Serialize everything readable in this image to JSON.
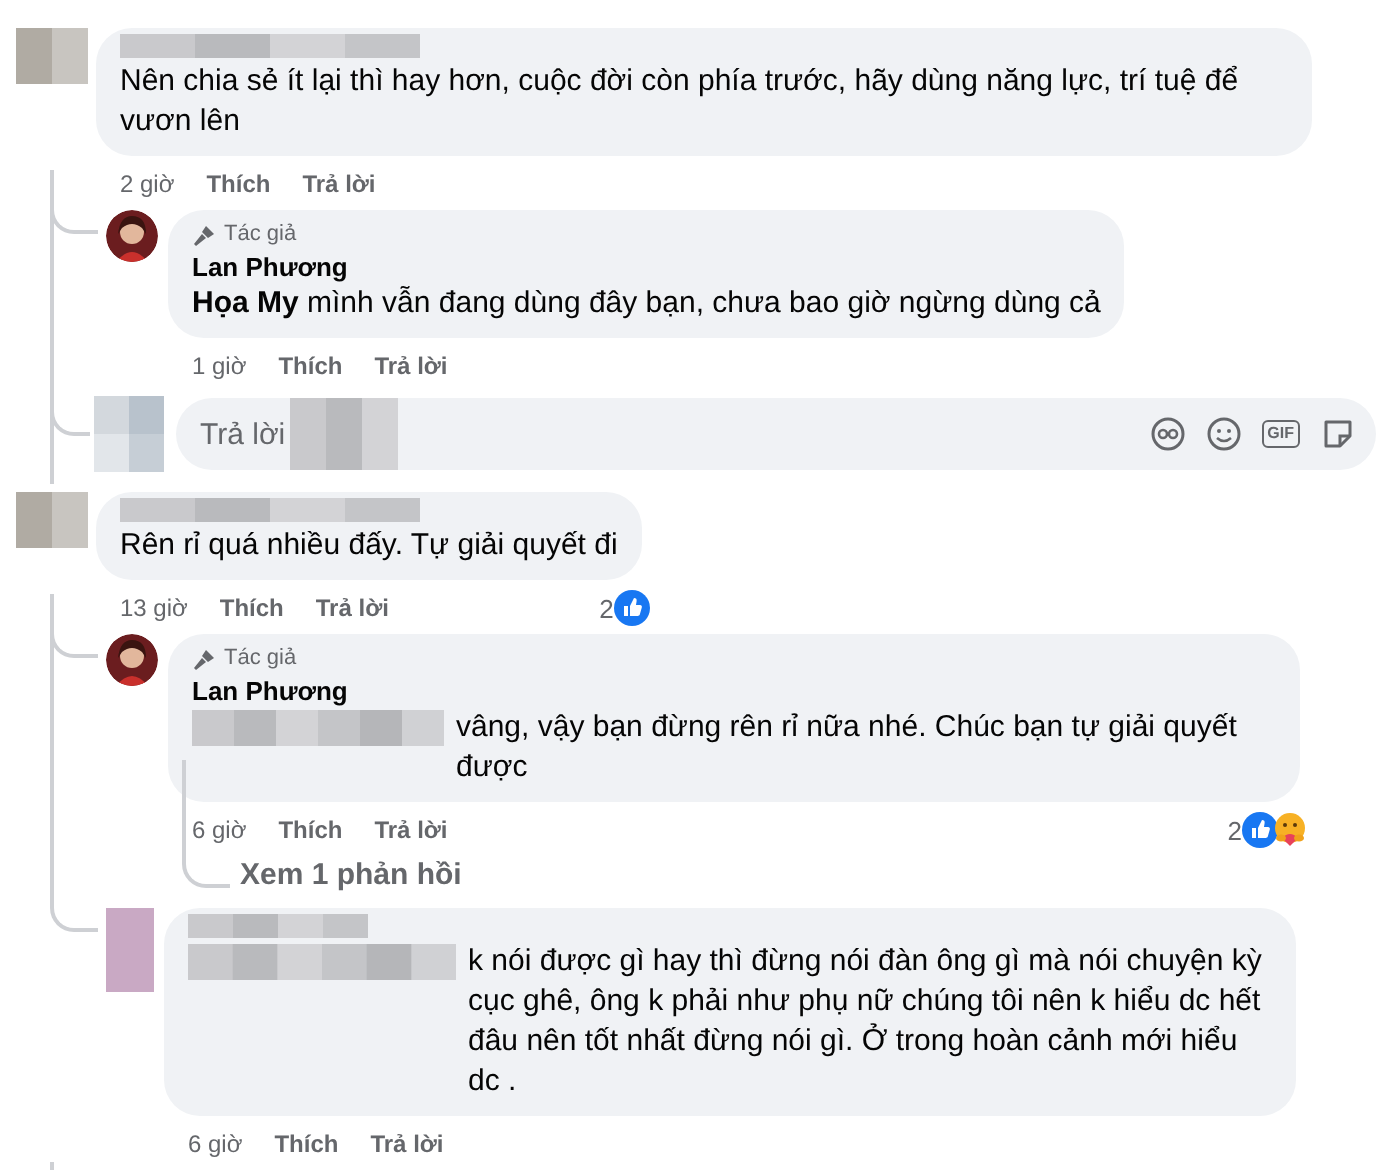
{
  "comments": [
    {
      "text": "Nên chia sẻ ít lại thì hay hơn, cuộc đời còn phía trước, hãy dùng năng lực, trí tuệ để vươn lên",
      "time": "2 giờ",
      "like": "Thích",
      "reply": "Trả lời",
      "replies": [
        {
          "author": "Lan Phương",
          "badge": "Tác giả",
          "text": "**Họa My** mình vẫn đang dùng đây bạn, chưa bao giờ ngừng dùng cả",
          "time": "1 giờ",
          "like": "Thích",
          "reply": "Trả lời"
        }
      ],
      "reply_box": {
        "placeholder": "Trả lời",
        "gif_label": "GIF"
      }
    },
    {
      "text": "Rên rỉ quá nhiều đấy. Tự giải quyết đi",
      "time": "13 giờ",
      "like": "Thích",
      "reply": "Trả lời",
      "reactions": {
        "count": "2",
        "icons": [
          {
            "kind": "like"
          }
        ]
      },
      "replies": [
        {
          "author": "Lan Phương",
          "badge": "Tác giả",
          "mention_redacted": true,
          "text": "vâng, vậy bạn đừng rên rỉ nữa nhé. Chúc bạn tự giải quyết được",
          "time": "6 giờ",
          "like": "Thích",
          "reply": "Trả lời",
          "reactions": {
            "count": "2",
            "icons": [
              {
                "kind": "like"
              },
              {
                "kind": "care"
              }
            ]
          },
          "view_replies": "Xem 1 phản hồi"
        },
        {
          "mention_redacted": true,
          "text": "k nói được gì hay thì đừng nói đàn ông gì mà nói chuyện kỳ cục ghê, ông k phải như phụ nữ chúng tôi nên k hiểu dc hết đâu nên tốt nhất đừng nói gì. Ở trong hoàn cảnh mới hiểu dc .",
          "time": "6 giờ",
          "like": "Thích",
          "reply": "Trả lời"
        }
      ]
    }
  ]
}
